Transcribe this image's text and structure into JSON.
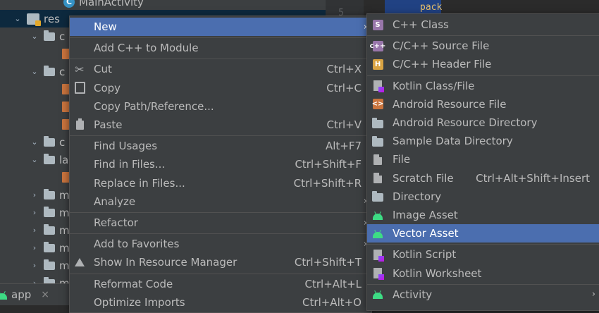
{
  "tree": {
    "top_item": "MainActivity",
    "res_label": "res",
    "rows": [
      {
        "kind": "folder",
        "label": "c",
        "indent": 1,
        "arrow": "down"
      },
      {
        "kind": "file",
        "label": "",
        "indent": 2
      },
      {
        "kind": "folder",
        "label": "c",
        "indent": 1,
        "arrow": "down"
      },
      {
        "kind": "file",
        "label": "",
        "indent": 2
      },
      {
        "kind": "file",
        "label": "",
        "indent": 2
      },
      {
        "kind": "file",
        "label": "",
        "indent": 2
      },
      {
        "kind": "folder",
        "label": "c",
        "indent": 1,
        "arrow": "down"
      },
      {
        "kind": "folder",
        "label": "la",
        "indent": 1,
        "arrow": "down"
      },
      {
        "kind": "file",
        "label": "",
        "indent": 2
      },
      {
        "kind": "folder",
        "label": "m",
        "indent": 1,
        "arrow": "right"
      },
      {
        "kind": "folder",
        "label": "m",
        "indent": 1,
        "arrow": "right"
      },
      {
        "kind": "folder",
        "label": "m",
        "indent": 1,
        "arrow": "right"
      },
      {
        "kind": "folder",
        "label": "m",
        "indent": 1,
        "arrow": "right"
      },
      {
        "kind": "folder",
        "label": "m",
        "indent": 1,
        "arrow": "right"
      },
      {
        "kind": "folder",
        "label": "m",
        "indent": 1,
        "arrow": "right"
      }
    ]
  },
  "gutter": {
    "line": "5"
  },
  "editor": {
    "code": "pack"
  },
  "bottom_tab": {
    "label": "app",
    "close": "×"
  },
  "context_menu": {
    "items": [
      {
        "name": "new",
        "label": "New",
        "shortcut": "",
        "submenu": true,
        "active": true,
        "icon": ""
      },
      {
        "sep": true
      },
      {
        "name": "add-cpp-to-module",
        "label": "Add C++ to Module",
        "shortcut": "",
        "icon": ""
      },
      {
        "sep": true
      },
      {
        "name": "cut",
        "label": "Cut",
        "shortcut": "Ctrl+X",
        "icon": "scissors-icon"
      },
      {
        "name": "copy",
        "label": "Copy",
        "shortcut": "Ctrl+C",
        "icon": "copy-icon"
      },
      {
        "name": "copy-path",
        "label": "Copy Path/Reference...",
        "shortcut": "",
        "icon": ""
      },
      {
        "name": "paste",
        "label": "Paste",
        "shortcut": "Ctrl+V",
        "icon": "paste-icon"
      },
      {
        "sep": true
      },
      {
        "name": "find-usages",
        "label": "Find Usages",
        "shortcut": "Alt+F7",
        "icon": ""
      },
      {
        "name": "find-in-files",
        "label": "Find in Files...",
        "shortcut": "Ctrl+Shift+F",
        "icon": ""
      },
      {
        "name": "replace-in-files",
        "label": "Replace in Files...",
        "shortcut": "Ctrl+Shift+R",
        "icon": ""
      },
      {
        "name": "analyze",
        "label": "Analyze",
        "shortcut": "",
        "submenu": true,
        "icon": ""
      },
      {
        "sep": true
      },
      {
        "name": "refactor",
        "label": "Refactor",
        "shortcut": "",
        "submenu": true,
        "icon": ""
      },
      {
        "sep": true
      },
      {
        "name": "add-to-favorites",
        "label": "Add to Favorites",
        "shortcut": "",
        "submenu": true,
        "icon": ""
      },
      {
        "name": "show-in-resource-manager",
        "label": "Show In Resource Manager",
        "shortcut": "Ctrl+Shift+T",
        "icon": "resource-manager-icon"
      },
      {
        "sep": true
      },
      {
        "name": "reformat-code",
        "label": "Reformat Code",
        "shortcut": "Ctrl+Alt+L",
        "icon": ""
      },
      {
        "name": "optimize-imports",
        "label": "Optimize Imports",
        "shortcut": "Ctrl+Alt+O",
        "icon": ""
      }
    ]
  },
  "new_submenu": {
    "items": [
      {
        "name": "cpp-class",
        "label": "C++ Class",
        "shortcut": "",
        "icon": "cpp-class-icon",
        "badge": "S",
        "color": "#9876aa"
      },
      {
        "sep": true
      },
      {
        "name": "cpp-source-file",
        "label": "C/C++ Source File",
        "shortcut": "",
        "icon": "cpp-source-icon",
        "badge": "c++",
        "color": "#9876aa"
      },
      {
        "name": "cpp-header-file",
        "label": "C/C++ Header File",
        "shortcut": "",
        "icon": "cpp-header-icon",
        "badge": "H",
        "color": "#d9a343"
      },
      {
        "sep": true
      },
      {
        "name": "kotlin-class-file",
        "label": "Kotlin Class/File",
        "shortcut": "",
        "icon": "kotlin-file-icon"
      },
      {
        "name": "android-resource-file",
        "label": "Android Resource File",
        "shortcut": "",
        "icon": "android-resource-file-icon",
        "badge": "<>",
        "color": "#c9743e"
      },
      {
        "name": "android-resource-directory",
        "label": "Android Resource Directory",
        "shortcut": "",
        "icon": "folder-icon"
      },
      {
        "name": "sample-data-directory",
        "label": "Sample Data Directory",
        "shortcut": "",
        "icon": "folder-icon"
      },
      {
        "name": "file",
        "label": "File",
        "shortcut": "",
        "icon": "file-icon"
      },
      {
        "name": "scratch-file",
        "label": "Scratch File",
        "shortcut": "Ctrl+Alt+Shift+Insert",
        "icon": "scratch-file-icon"
      },
      {
        "name": "directory",
        "label": "Directory",
        "shortcut": "",
        "icon": "folder-icon"
      },
      {
        "name": "image-asset",
        "label": "Image Asset",
        "shortcut": "",
        "icon": "android-icon"
      },
      {
        "name": "vector-asset",
        "label": "Vector Asset",
        "shortcut": "",
        "icon": "android-icon",
        "active": true
      },
      {
        "sep": true
      },
      {
        "name": "kotlin-script",
        "label": "Kotlin Script",
        "shortcut": "",
        "icon": "kotlin-file-icon"
      },
      {
        "name": "kotlin-worksheet",
        "label": "Kotlin Worksheet",
        "shortcut": "",
        "icon": "kotlin-file-icon"
      },
      {
        "sep": true
      },
      {
        "name": "activity",
        "label": "Activity",
        "shortcut": "",
        "icon": "android-icon",
        "submenu": true
      }
    ]
  }
}
